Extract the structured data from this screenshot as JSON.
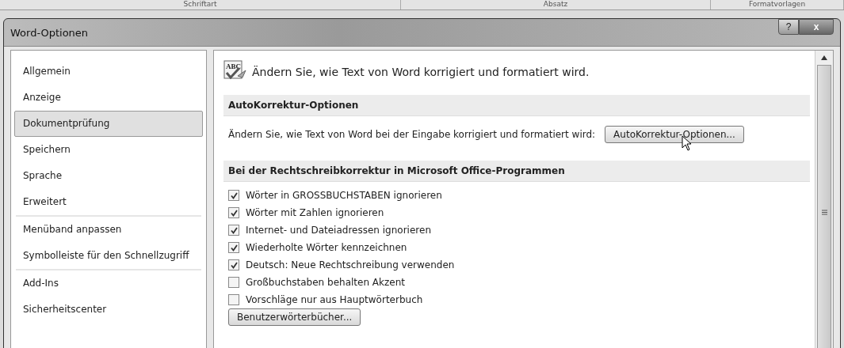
{
  "ribbon": {
    "groups": [
      "Schriftart",
      "Absatz",
      "Formatvorlagen"
    ]
  },
  "window": {
    "title": "Word-Optionen",
    "buttons": [
      {
        "kind": "help",
        "label": "?"
      },
      {
        "kind": "close",
        "label": "x"
      }
    ]
  },
  "sidebar": {
    "groups": [
      [
        {
          "label": "Allgemein",
          "selected": false
        },
        {
          "label": "Anzeige",
          "selected": false
        },
        {
          "label": "Dokumentprüfung",
          "selected": true
        },
        {
          "label": "Speichern",
          "selected": false
        },
        {
          "label": "Sprache",
          "selected": false
        },
        {
          "label": "Erweitert",
          "selected": false
        }
      ],
      [
        {
          "label": "Menüband anpassen",
          "selected": false
        },
        {
          "label": "Symbolleiste für den Schnellzugriff",
          "selected": false
        }
      ],
      [
        {
          "label": "Add-Ins",
          "selected": false
        },
        {
          "label": "Sicherheitscenter",
          "selected": false
        }
      ]
    ]
  },
  "header_icon_text": "ABC",
  "header": "Ändern Sie, wie Text von Word korrigiert und formatiert wird.",
  "sections": [
    {
      "title": "AutoKorrektur-Optionen",
      "rows": [
        {
          "kind": "button_row",
          "text": "Ändern Sie, wie Text von Word bei der Eingabe korrigiert und formatiert wird:",
          "button": "AutoKorrektur-Optionen..."
        }
      ]
    },
    {
      "title": "Bei der Rechtschreibkorrektur in Microsoft Office-Programmen",
      "rows": [
        {
          "kind": "checkbox",
          "label": "Wörter in GROSSBUCHSTABEN ignorieren",
          "checked": true
        },
        {
          "kind": "checkbox",
          "label": "Wörter mit Zahlen ignorieren",
          "checked": true
        },
        {
          "kind": "checkbox",
          "label": "Internet- und Dateiadressen ignorieren",
          "checked": true
        },
        {
          "kind": "checkbox",
          "label": "Wiederholte Wörter kennzeichnen",
          "checked": true
        },
        {
          "kind": "checkbox",
          "label": "Deutsch: Neue Rechtschreibung verwenden",
          "checked": true
        },
        {
          "kind": "checkbox",
          "label": "Großbuchstaben behalten Akzent",
          "checked": false
        },
        {
          "kind": "checkbox",
          "label": "Vorschläge nur aus Hauptwörterbuch",
          "checked": false
        },
        {
          "kind": "button",
          "button": "Benutzerwörterbücher..."
        }
      ]
    }
  ]
}
